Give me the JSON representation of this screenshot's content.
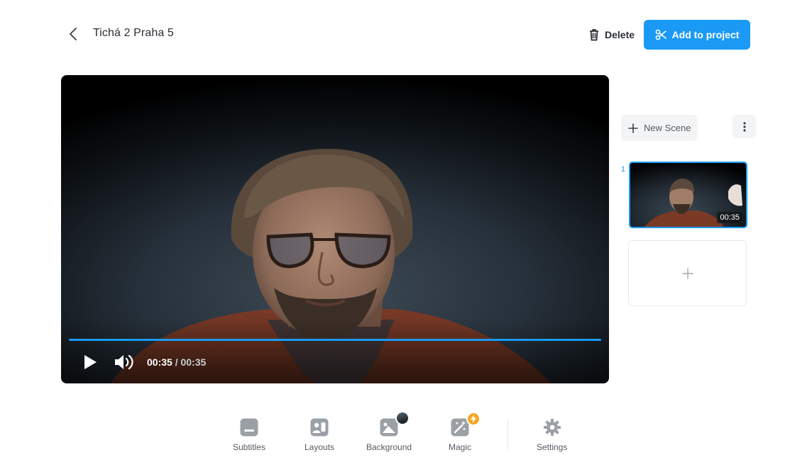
{
  "header": {
    "title": "Tichá 2 Praha 5",
    "delete_label": "Delete",
    "add_to_project_label": "Add to project"
  },
  "player": {
    "current_time": "00:35",
    "separator": "/",
    "duration": "00:35",
    "progress_fraction": 1.0
  },
  "scenes": {
    "new_scene_label": "New Scene",
    "items": [
      {
        "index": "1",
        "duration": "00:35"
      }
    ]
  },
  "toolbar": {
    "items": [
      {
        "label": "Subtitles"
      },
      {
        "label": "Layouts"
      },
      {
        "label": "Background"
      },
      {
        "label": "Magic"
      },
      {
        "label": "Settings"
      }
    ]
  },
  "colors": {
    "accent": "#1a9af5",
    "magic_badge": "#f6a623",
    "icon_gray": "#9aa0a6"
  }
}
